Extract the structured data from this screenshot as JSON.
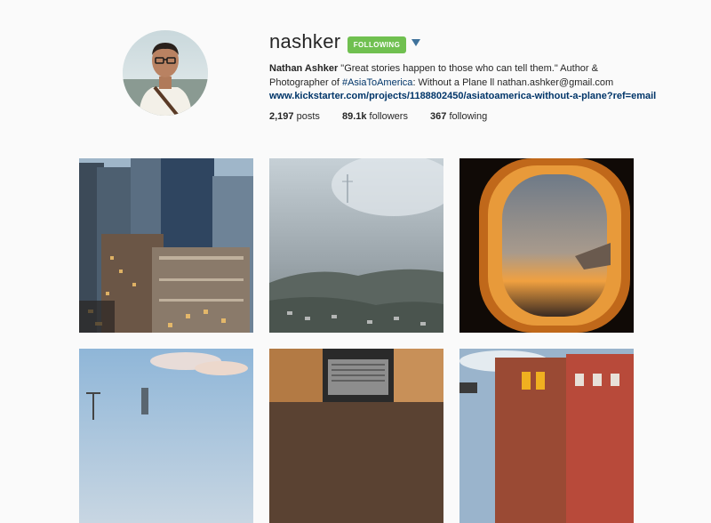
{
  "profile": {
    "username": "nashker",
    "follow_label": "FOLLOWING",
    "name": "Nathan Ashker",
    "bio_part1": " \"Great stories happen to those who can tell them.\" Author & Photographer of ",
    "hashtag": "#AsiaToAmerica",
    "bio_part2": ": Without a Plane ll nathan.ashker@gmail.com",
    "website": "www.kickstarter.com/projects/1188802450/asiatoamerica-without-a-plane?ref=email"
  },
  "stats": {
    "posts_count": "2,197",
    "posts_label": "posts",
    "followers_count": "89.1k",
    "followers_label": "followers",
    "following_count": "367",
    "following_label": "following"
  },
  "colors": {
    "follow_button": "#70c050",
    "link": "#003569",
    "background": "#fafafa"
  },
  "icons": {
    "dropdown": "triangle-down-icon"
  }
}
